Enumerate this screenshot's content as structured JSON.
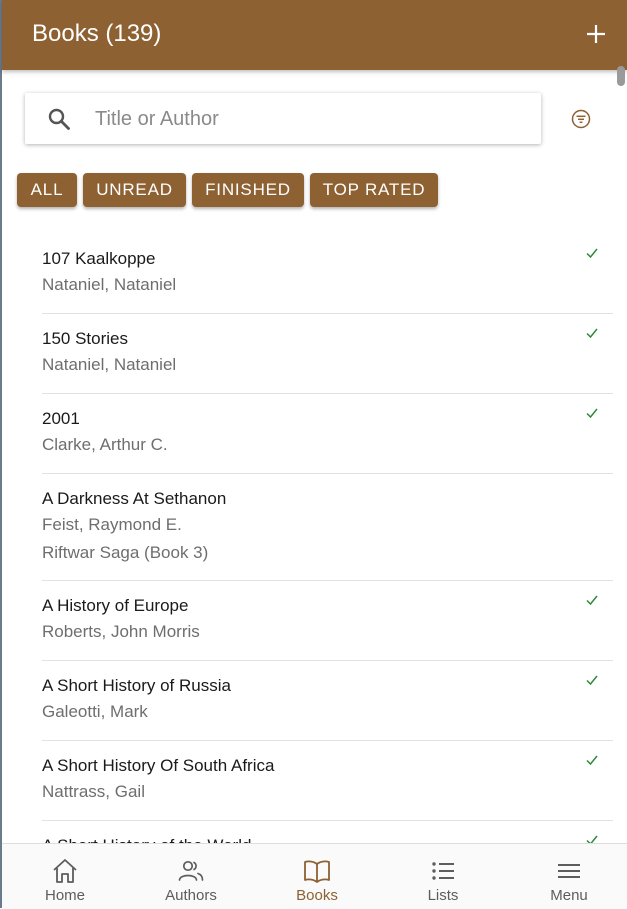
{
  "header": {
    "title": "Books (139)",
    "add_icon": "plus-icon"
  },
  "search": {
    "placeholder": "Title or Author",
    "value": "",
    "icon": "search-icon",
    "filter_icon": "filter-icon"
  },
  "filters": [
    "ALL",
    "UNREAD",
    "FINISHED",
    "TOP RATED"
  ],
  "books": [
    {
      "title": "107 Kaalkoppe",
      "author": "Nataniel, Nataniel",
      "finished": true
    },
    {
      "title": "150 Stories",
      "author": "Nataniel, Nataniel",
      "finished": true
    },
    {
      "title": "2001",
      "author": "Clarke, Arthur C.",
      "finished": true
    },
    {
      "title": "A Darkness At Sethanon",
      "author": "Feist, Raymond E.",
      "series": "Riftwar Saga (Book 3)",
      "finished": false
    },
    {
      "title": "A History of Europe",
      "author": "Roberts, John Morris",
      "finished": true
    },
    {
      "title": "A Short History of Russia",
      "author": "Galeotti, Mark",
      "finished": true
    },
    {
      "title": "A Short History Of South Africa",
      "author": "Nattrass, Gail",
      "finished": true
    },
    {
      "title": "A Short History of the World",
      "author": "",
      "finished": true
    }
  ],
  "nav": [
    {
      "label": "Home",
      "icon": "home-icon",
      "active": false
    },
    {
      "label": "Authors",
      "icon": "authors-icon",
      "active": false
    },
    {
      "label": "Books",
      "icon": "book-icon",
      "active": true
    },
    {
      "label": "Lists",
      "icon": "list-icon",
      "active": false
    },
    {
      "label": "Menu",
      "icon": "menu-icon",
      "active": false
    }
  ],
  "colors": {
    "primary": "#8e6133",
    "check": "#2e8b3a",
    "muted_text": "#6e6e6e"
  }
}
